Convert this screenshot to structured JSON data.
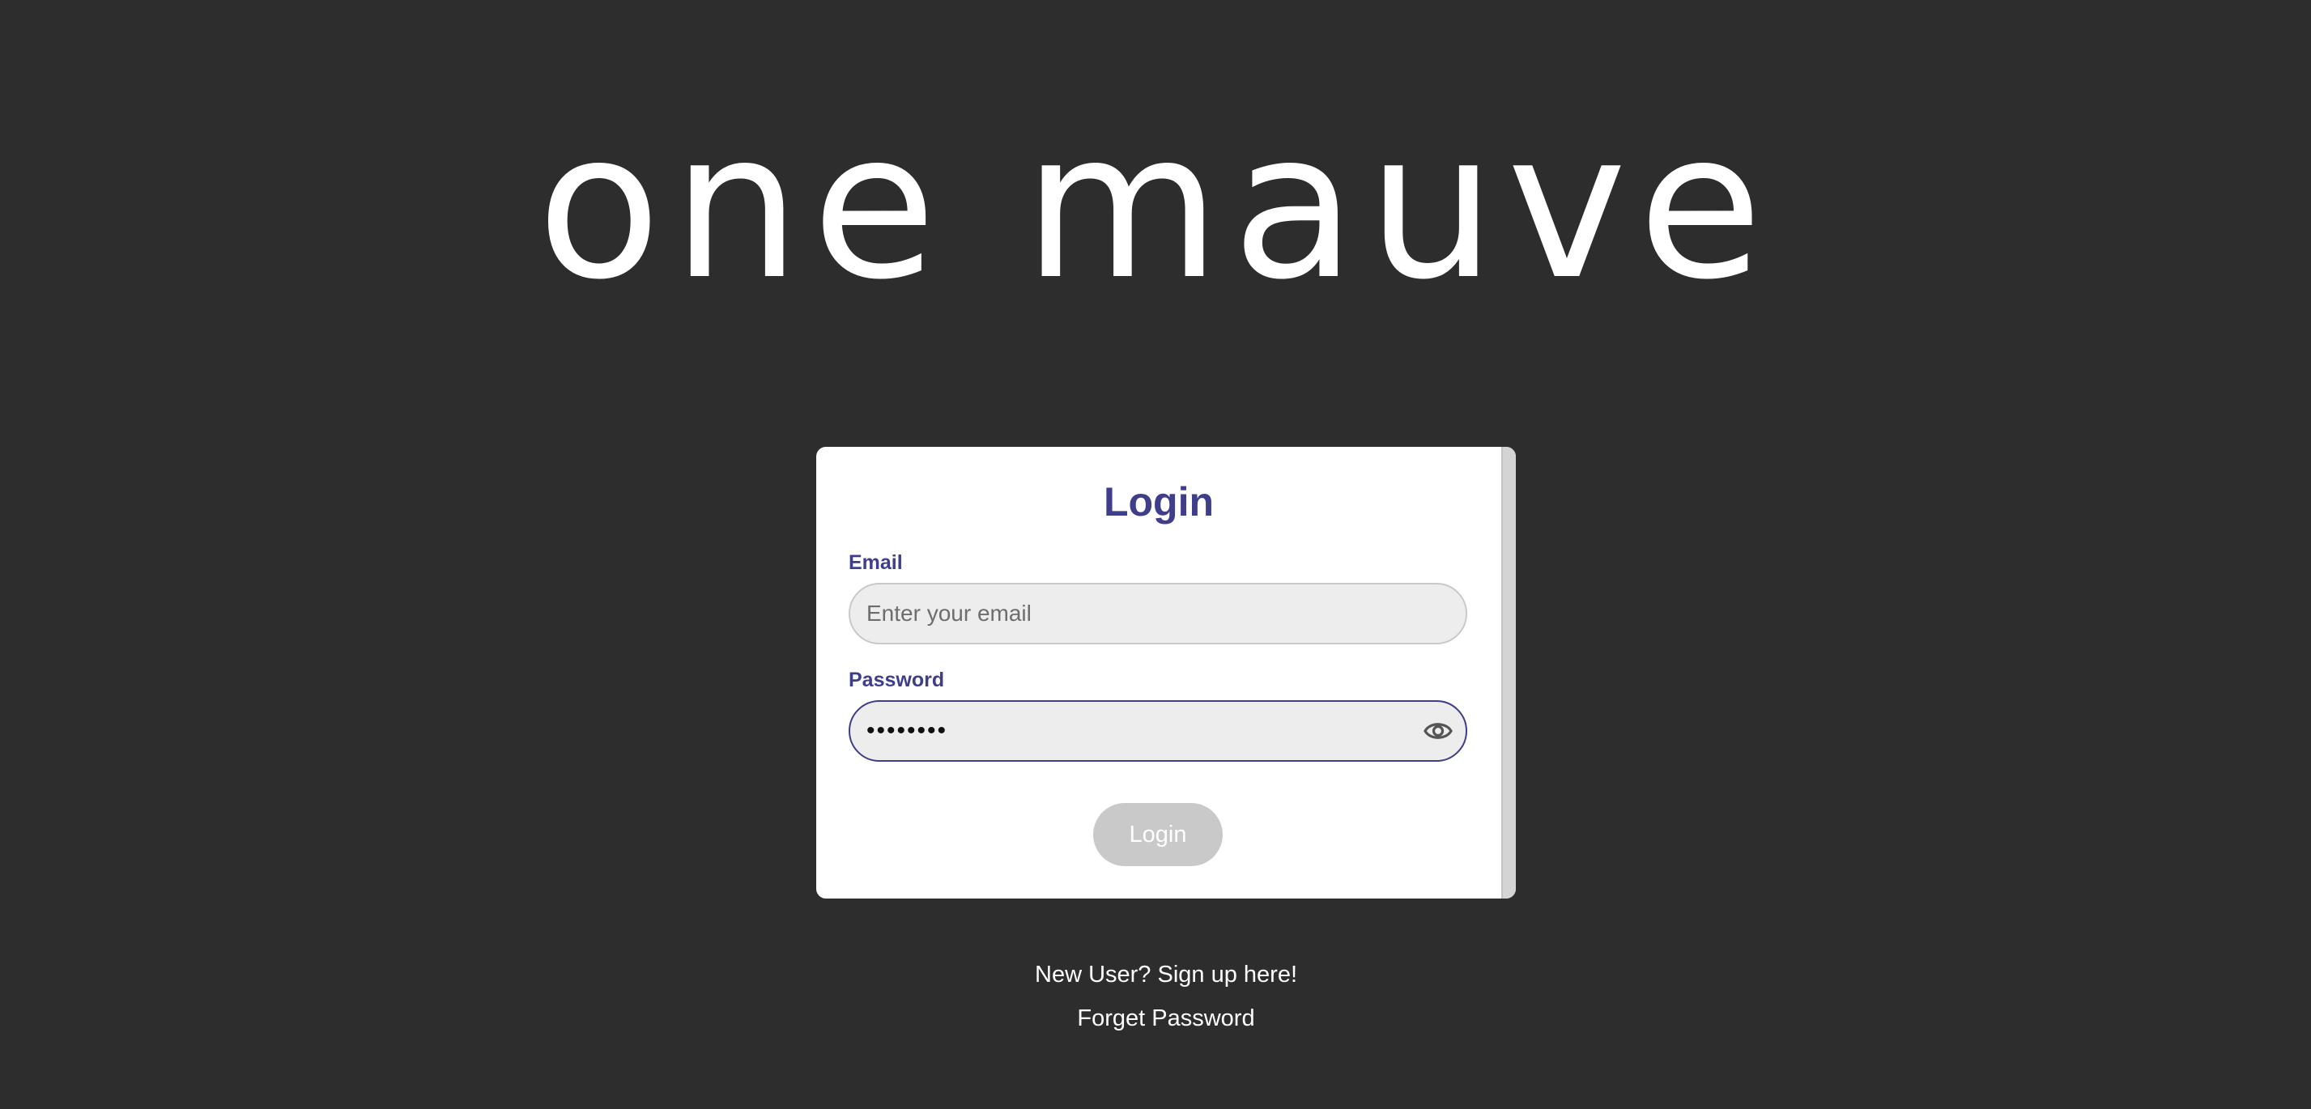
{
  "logo": {
    "text": "one mauve"
  },
  "login_card": {
    "title": "Login",
    "email": {
      "label": "Email",
      "placeholder": "Enter your email",
      "value": ""
    },
    "password": {
      "label": "Password",
      "value": "••••••••",
      "toggle_icon": "eye-icon"
    },
    "submit_label": "Login"
  },
  "links": {
    "signup": "New User? Sign up here!",
    "forgot_password": "Forget Password"
  },
  "colors": {
    "background": "#2d2d2d",
    "accent": "#3e3e8a",
    "button_disabled": "#c9c9c9"
  }
}
